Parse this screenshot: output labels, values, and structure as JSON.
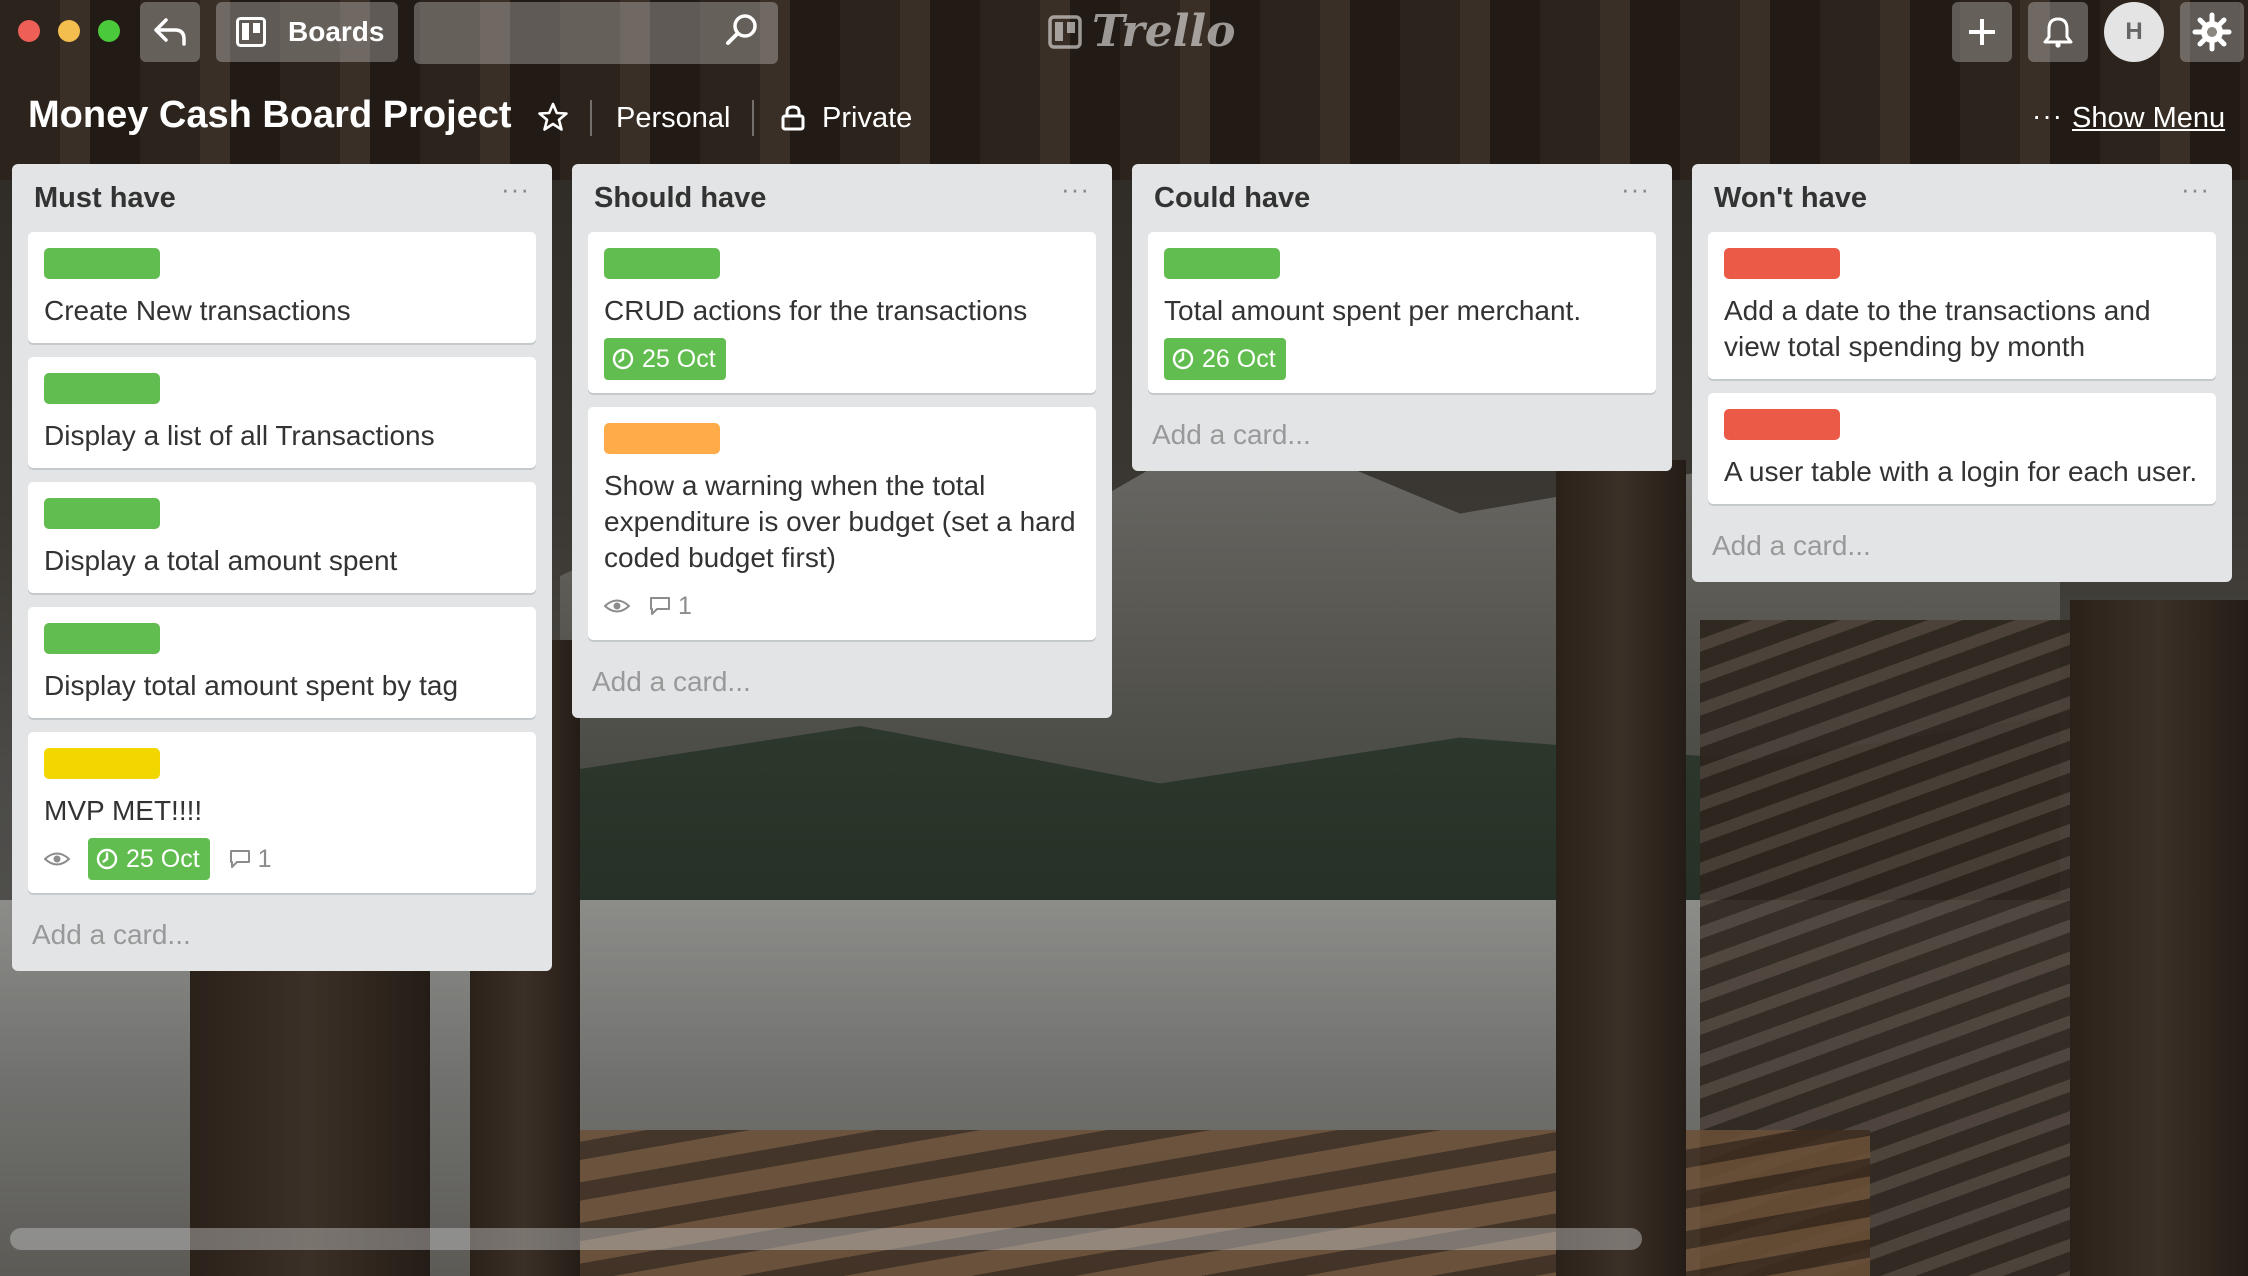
{
  "window": {
    "controls": {
      "close_color": "#ee5f57",
      "minimize_color": "#f4be4f",
      "maximize_color": "#4ac93a"
    }
  },
  "topbar": {
    "back_icon": "back-arrow-icon",
    "boards_label": "Boards",
    "search_value": "",
    "logo_text": "Trello",
    "add_icon": "plus-icon",
    "notification_icon": "bell-icon",
    "avatar_initial": "H",
    "settings_icon": "gear-icon"
  },
  "board": {
    "title": "Money Cash Board Project",
    "team": "Personal",
    "privacy": "Private",
    "menu_dots": "···",
    "show_menu": "Show Menu"
  },
  "colors": {
    "green": "#61bd4f",
    "orange": "#ffab4a",
    "red": "#eb5a46",
    "yellow": "#f2d600",
    "list_bg": "#e2e4e6"
  },
  "lists": [
    {
      "title": "Must have",
      "menu": "···",
      "cards": [
        {
          "label_color": "green",
          "title": "Create New transactions"
        },
        {
          "label_color": "green",
          "title": "Display a list of all Transactions"
        },
        {
          "label_color": "green",
          "title": "Display a total amount spent"
        },
        {
          "label_color": "green",
          "title": "Display total amount spent by tag"
        },
        {
          "label_color": "yellow",
          "title": "MVP MET!!!!",
          "watch": true,
          "due": "25 Oct",
          "comments": "1"
        }
      ],
      "add_card": "Add a card..."
    },
    {
      "title": "Should have",
      "menu": "···",
      "cards": [
        {
          "label_color": "green",
          "title": "CRUD actions for the transactions",
          "due": "25 Oct"
        },
        {
          "label_color": "orange",
          "title": "Show a warning when the total expenditure is over budget (set a hard coded budget first)",
          "watch": true,
          "comments": "1"
        }
      ],
      "add_card": "Add a card..."
    },
    {
      "title": "Could have",
      "menu": "···",
      "cards": [
        {
          "label_color": "green",
          "title": "Total amount spent per merchant.",
          "due": "26 Oct"
        }
      ],
      "add_card": "Add a card..."
    },
    {
      "title": "Won't have",
      "menu": "···",
      "cards": [
        {
          "label_color": "red",
          "title": "Add a date to the transactions and view total spending by month"
        },
        {
          "label_color": "red",
          "title": "A user table with a login for each user."
        }
      ],
      "add_card": "Add a card..."
    }
  ]
}
